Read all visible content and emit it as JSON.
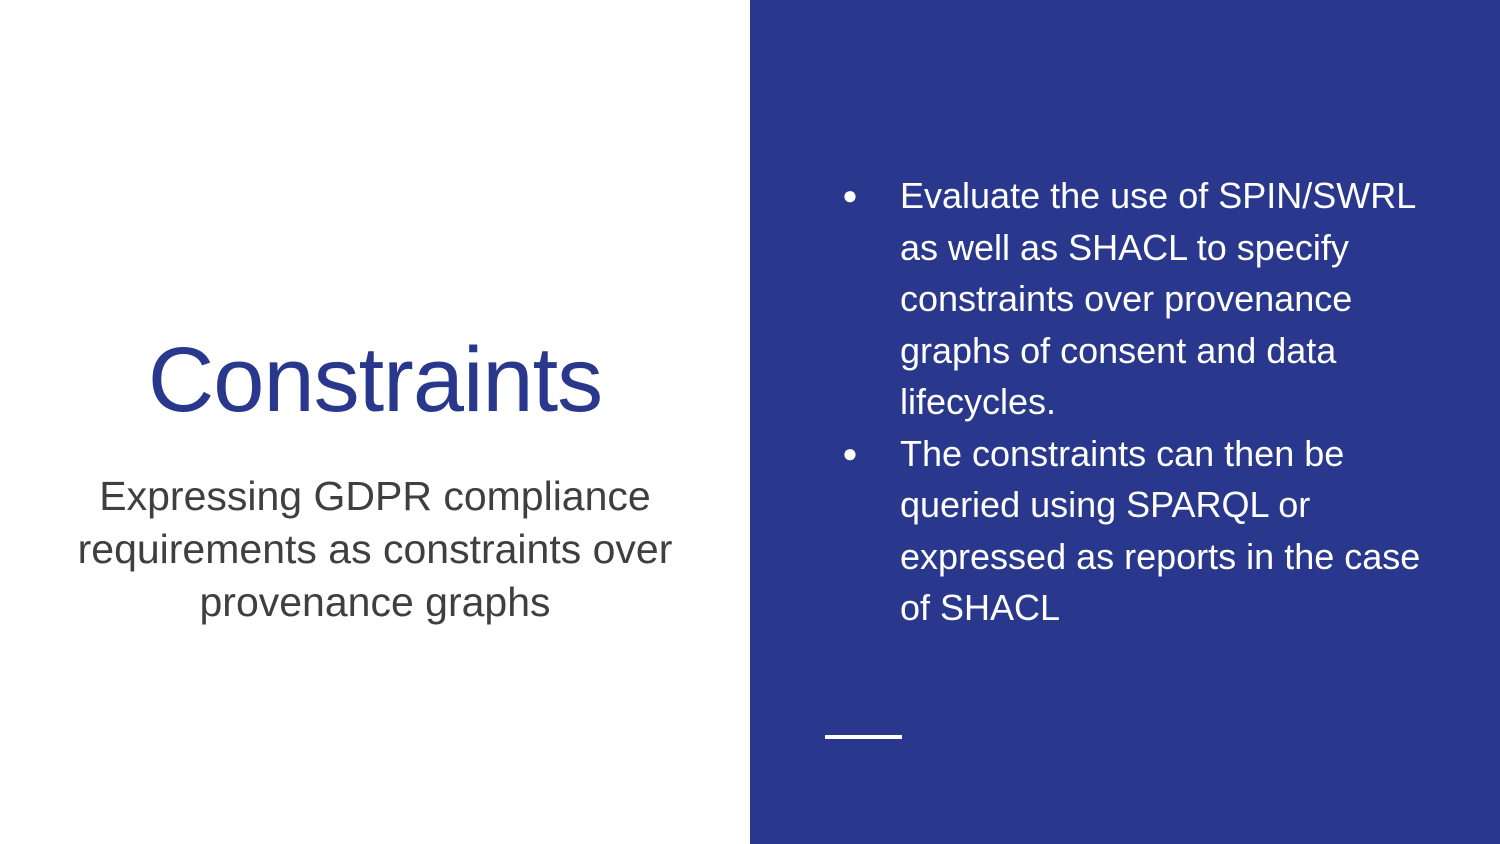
{
  "slide": {
    "title": "Constraints",
    "subtitle": "Expressing GDPR compliance requirements as constraints over provenance graphs",
    "bullets": [
      {
        "icon": "bullet-dot",
        "text": "Evaluate the use of SPIN/SWRL as well as SHACL to specify constraints over provenance graphs of consent and data lifecycles."
      },
      {
        "icon": "bullet-dot",
        "text": "The constraints can then be queried using SPARQL or expressed as reports in the case of SHACL"
      }
    ],
    "bullet_glyph": "●"
  },
  "colors": {
    "accent": "#29388c",
    "background": "#ffffff",
    "subtitle_text": "#3f3f3f",
    "bullet_text": "#ffffff"
  }
}
